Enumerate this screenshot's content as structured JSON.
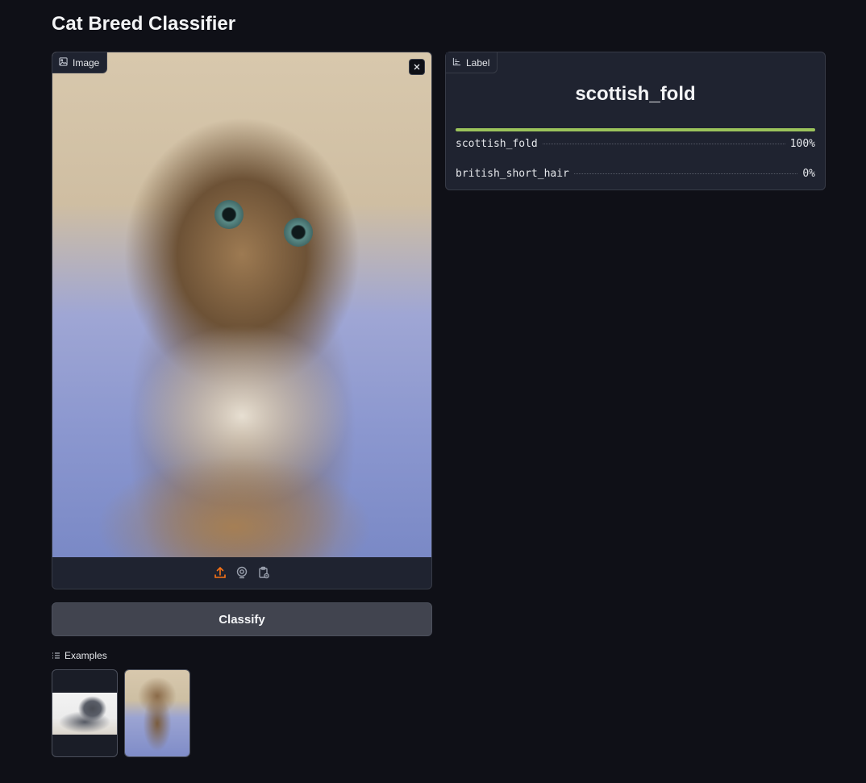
{
  "app": {
    "title": "Cat Breed Classifier"
  },
  "image_panel": {
    "label": "Image",
    "icons": {
      "tag": "image-icon",
      "close": "close-icon",
      "upload": "upload-icon",
      "webcam": "webcam-icon",
      "clipboard": "clipboard-icon"
    },
    "accent": "#f97316"
  },
  "classify_button": {
    "label": "Classify"
  },
  "examples": {
    "title": "Examples",
    "icon": "list-icon",
    "items": [
      {
        "name": "gray-cat-example"
      },
      {
        "name": "tabby-kitten-example"
      }
    ]
  },
  "label_panel": {
    "label": "Label",
    "icon": "bar-chart-icon",
    "prediction": "scottish_fold",
    "confidences": [
      {
        "label": "scottish_fold",
        "value": "100%",
        "fraction": 1.0
      },
      {
        "label": "british_short_hair",
        "value": "0%",
        "fraction": 0.0
      }
    ],
    "bar_color": "#9bc35b"
  }
}
